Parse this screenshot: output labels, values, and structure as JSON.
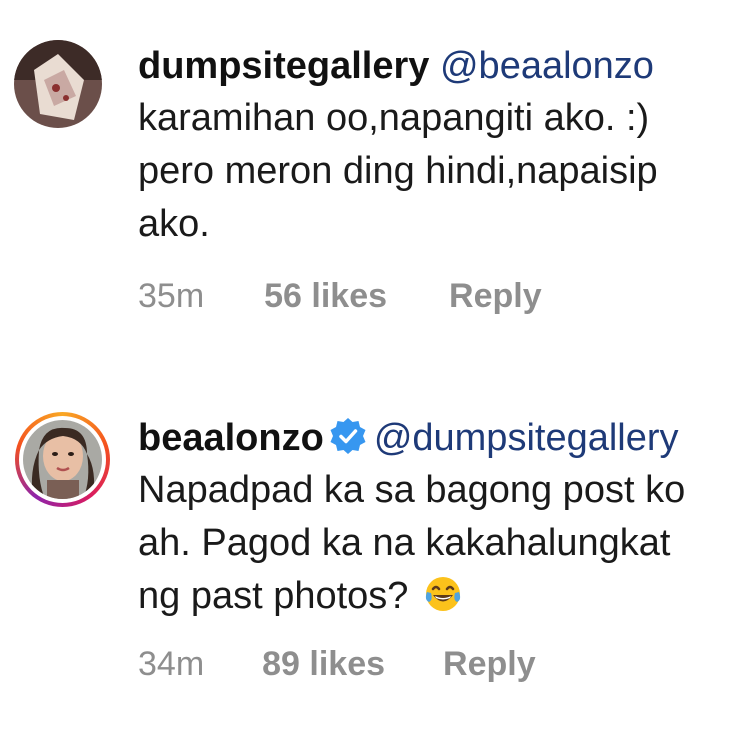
{
  "comments": [
    {
      "username": "dumpsitegallery",
      "mention": "@beaalonzo",
      "text_lines": [
        "karamihan oo,napangiti ako. :)",
        "pero meron ding hindi,napaisip",
        "ako."
      ],
      "time": "35m",
      "likes": "56 likes",
      "reply": "Reply",
      "avatar_icon": "user-avatar",
      "verified": false
    },
    {
      "username": "beaalonzo",
      "mention": "@dumpsitegallery",
      "text_lines": [
        "Napadpad ka sa bagong post ko",
        "ah. Pagod ka na kakahalungkat",
        "ng past photos?"
      ],
      "emoji": "tears-of-joy-emoji",
      "time": "34m",
      "likes": "89 likes",
      "reply": "Reply",
      "avatar_icon": "user-avatar-story-ring",
      "verified": true,
      "verified_color": "#3797f0"
    }
  ],
  "colors": {
    "mention": "#1e3a78",
    "meta": "#8e8e8e",
    "text": "#1a1a1a"
  }
}
